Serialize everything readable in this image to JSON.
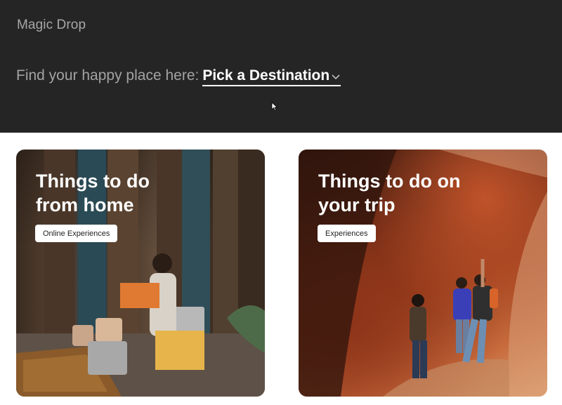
{
  "header": {
    "brand": "Magic Drop",
    "prompt_text": "Find your happy place here:",
    "destination_link": "Pick a Destination"
  },
  "cards": [
    {
      "title_line1": "Things to do",
      "title_line2": "from home",
      "button_label": "Online Experiences"
    },
    {
      "title_line1": "Things to do on",
      "title_line2": "your trip",
      "button_label": "Experiences"
    }
  ],
  "icons": {
    "chevron": "chevron-down-icon",
    "cursor": "mouse-cursor-icon"
  },
  "colors": {
    "header_bg": "#252525",
    "brand_text": "#a7a7a7",
    "link_text": "#ffffff"
  }
}
